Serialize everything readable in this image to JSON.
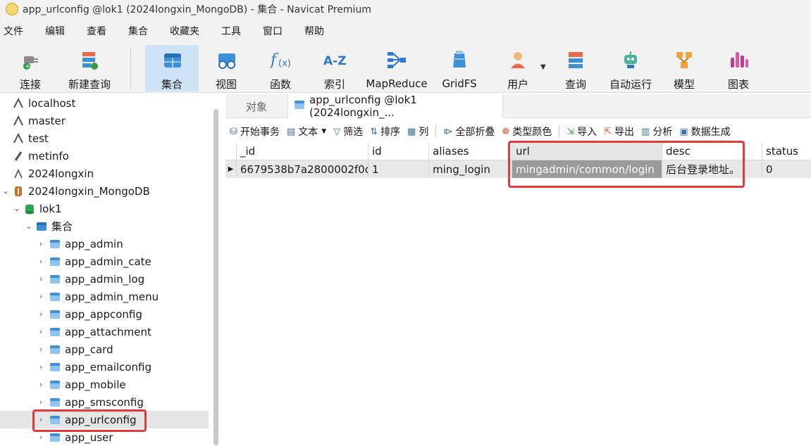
{
  "window": {
    "title": "app_urlconfig @lok1 (2024longxin_MongoDB) - 集合 - Navicat Premium"
  },
  "menu": [
    "文件",
    "编辑",
    "查看",
    "集合",
    "收藏夹",
    "工具",
    "窗口",
    "帮助"
  ],
  "toolbar": {
    "connect": "连接",
    "new_query": "新建查询",
    "collection": "集合",
    "view": "视图",
    "function": "函数",
    "index": "索引",
    "mapreduce": "MapReduce",
    "gridfs": "GridFS",
    "user": "用户",
    "query": "查询",
    "automation": "自动运行",
    "model": "模型",
    "chart": "图表"
  },
  "sidebar": {
    "items": [
      {
        "label": "localhost"
      },
      {
        "label": "master"
      },
      {
        "label": "test"
      },
      {
        "label": "metinfo"
      },
      {
        "label": "2024longxin"
      },
      {
        "label": "2024longxin_MongoDB"
      },
      {
        "label": "lok1"
      },
      {
        "label": "集合"
      },
      {
        "label": "app_admin"
      },
      {
        "label": "app_admin_cate"
      },
      {
        "label": "app_admin_log"
      },
      {
        "label": "app_admin_menu"
      },
      {
        "label": "app_appconfig"
      },
      {
        "label": "app_attachment"
      },
      {
        "label": "app_card"
      },
      {
        "label": "app_emailconfig"
      },
      {
        "label": "app_mobile"
      },
      {
        "label": "app_smsconfig"
      },
      {
        "label": "app_urlconfig"
      },
      {
        "label": "app_user"
      }
    ],
    "selected": "app_urlconfig"
  },
  "tabs": {
    "objects": "对象",
    "active": "app_urlconfig @lok1 (2024longxin_..."
  },
  "subtoolbar": {
    "begin_transaction": "开始事务",
    "text": "文本",
    "filter": "筛选",
    "sort": "排序",
    "columns": "列",
    "collapse_all": "全部折叠",
    "type_color": "类型颜色",
    "import": "导入",
    "export": "导出",
    "analyze": "分析",
    "data_gen": "数据生成"
  },
  "table": {
    "columns": [
      "_id",
      "id",
      "aliases",
      "url",
      "desc",
      "status"
    ],
    "rows": [
      [
        "6679538b7a2800002f0c",
        "1",
        "ming_login",
        "mingadmin/common/login",
        "后台登录地址。",
        "0"
      ]
    ]
  },
  "colors": {
    "highlight": "#e8383d",
    "accent": "#2b79d0",
    "selected_header": "#cfe3f6"
  }
}
